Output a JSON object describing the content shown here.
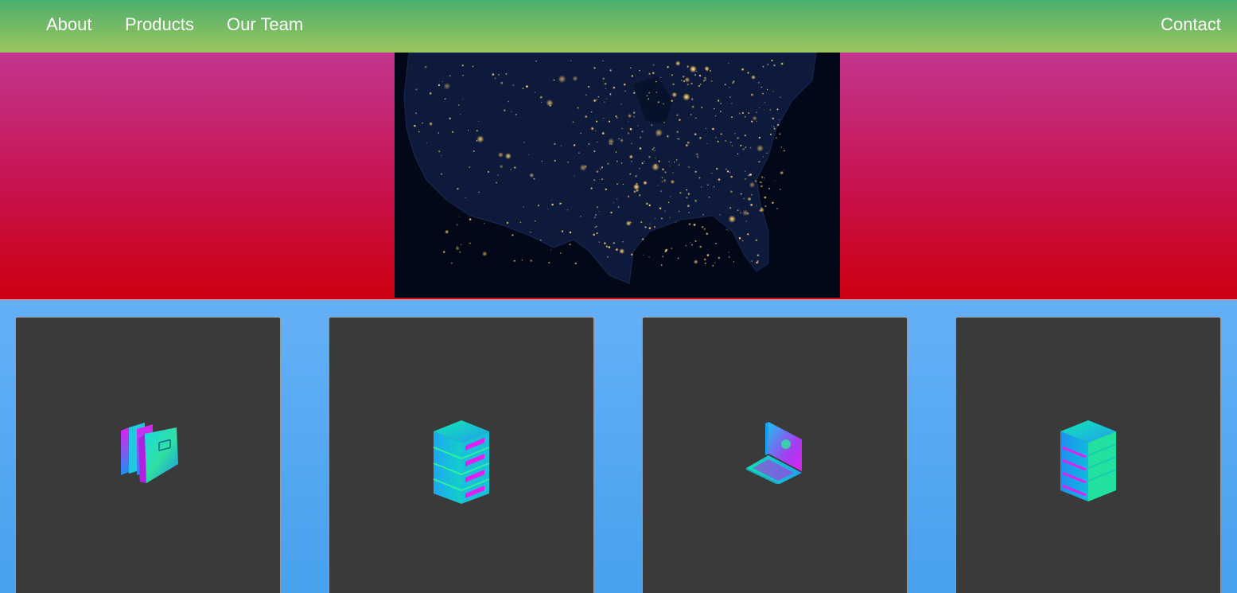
{
  "nav": {
    "links": [
      "About",
      "Products",
      "Our Team"
    ],
    "contact": "Contact"
  },
  "hero": {
    "image": "usa-night-lights-map"
  },
  "cards": [
    {
      "icon": "folders-icon"
    },
    {
      "icon": "server-rack-icon"
    },
    {
      "icon": "laptop-icon"
    },
    {
      "icon": "database-server-icon"
    }
  ],
  "colors": {
    "nav_top": "#4caf6e",
    "nav_bottom": "#9bc55c",
    "hero_top": "#c2358f",
    "hero_bottom": "#cc0010",
    "cards_bg": "#5aa8f3",
    "card_bg": "#3a3a3a",
    "icon_teal": "#14e0c0",
    "icon_magenta": "#e020f0",
    "icon_blue": "#1aa0f0"
  }
}
